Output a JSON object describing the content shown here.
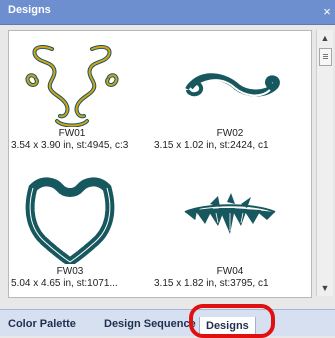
{
  "window": {
    "title": "Designs",
    "close_glyph": "×"
  },
  "designs": [
    {
      "name": "FW01",
      "info": "3.54 x 3.90 in, st:4945, c:3",
      "icon": "flourish-necklace-icon"
    },
    {
      "name": "FW02",
      "info": "3.15 x 1.02 in, st:2424, c1",
      "icon": "swirl-wave-icon"
    },
    {
      "name": "FW03",
      "info": "5.04 x 4.65 in, st:1071...",
      "icon": "chain-necklace-icon"
    },
    {
      "name": "FW04",
      "info": "3.15 x 1.82 in, st:3795, c1",
      "icon": "leaf-garland-icon"
    }
  ],
  "tabs": [
    {
      "label": "Color Palette"
    },
    {
      "label": "Design Sequence"
    },
    {
      "label": "Designs",
      "active": true
    }
  ],
  "colors": {
    "titlebar": "#6e8fcf",
    "embroidery_dark": "#17575e",
    "embroidery_gold": "#d4a21a",
    "highlight": "#e01010"
  }
}
